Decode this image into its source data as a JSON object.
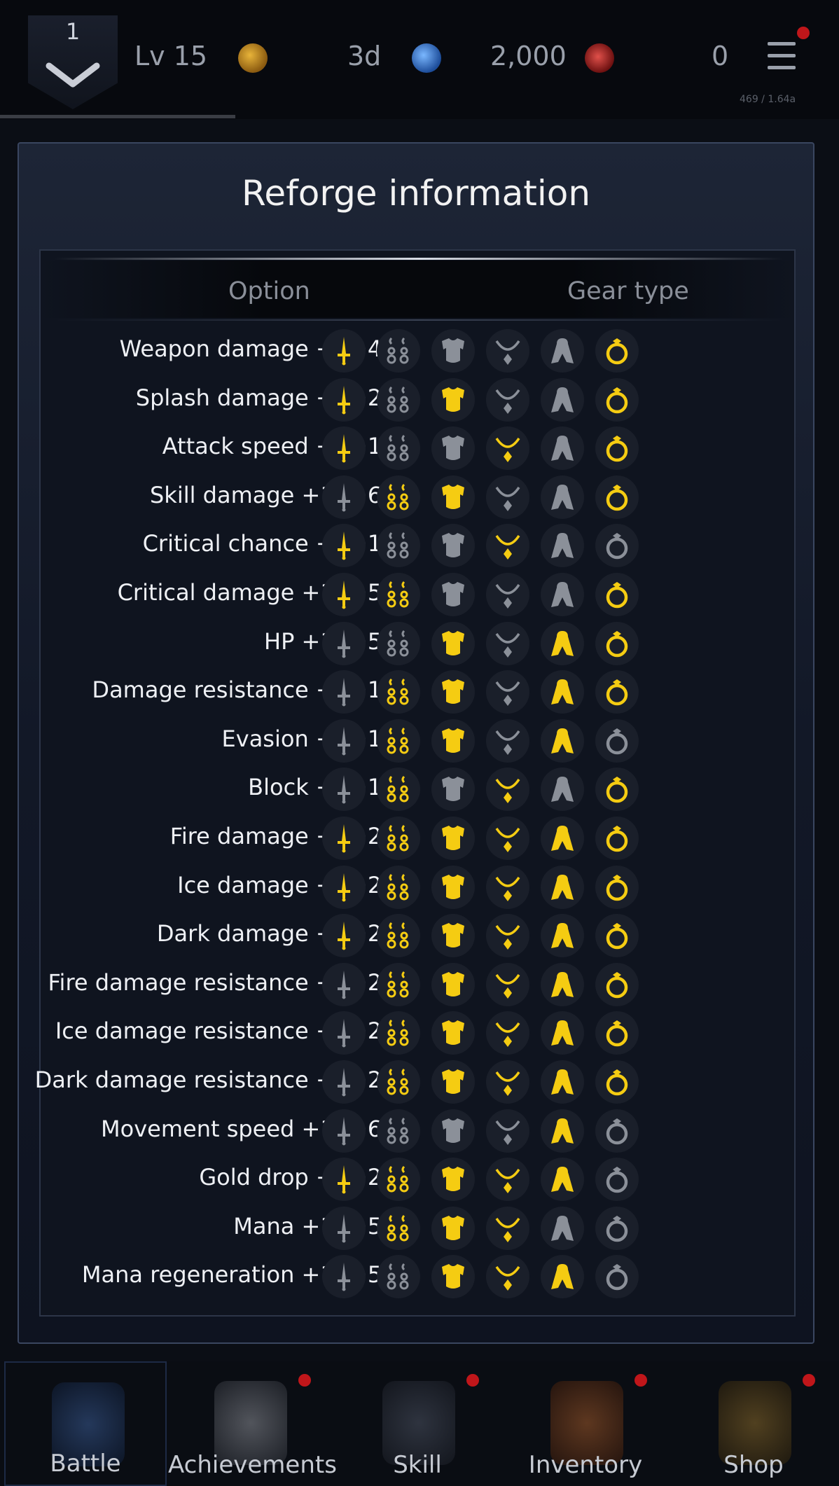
{
  "header": {
    "rank": "1",
    "level": "Lv 15",
    "resources": [
      {
        "icon": "gold-coin-icon",
        "value": "3d"
      },
      {
        "icon": "globe-gem-icon",
        "value": "2,000"
      },
      {
        "icon": "ruby-icon",
        "value": "0"
      }
    ],
    "exp_text": "469 / 1.64a"
  },
  "dialog": {
    "title": "Reforge information",
    "columns": {
      "option": "Option",
      "gear_type": "Gear type"
    },
    "gear_icons": [
      "sword-icon",
      "earring-icon",
      "armor-icon",
      "necklace-icon",
      "cloak-icon",
      "ring-icon"
    ],
    "rows": [
      {
        "label": "Weapon damage +8~40%",
        "gear": [
          1,
          0,
          0,
          0,
          0,
          1
        ]
      },
      {
        "label": "Splash damage +5~25%",
        "gear": [
          1,
          0,
          1,
          0,
          0,
          1
        ]
      },
      {
        "label": "Attack speed +2~10%",
        "gear": [
          1,
          0,
          0,
          1,
          0,
          1
        ]
      },
      {
        "label": "Skill damage +12~60%",
        "gear": [
          0,
          1,
          1,
          0,
          0,
          1
        ]
      },
      {
        "label": "Critical chance +2~10%",
        "gear": [
          1,
          0,
          0,
          1,
          0,
          0
        ]
      },
      {
        "label": "Critical damage +10~50%",
        "gear": [
          1,
          1,
          0,
          0,
          0,
          1
        ]
      },
      {
        "label": "HP +10~50%",
        "gear": [
          0,
          0,
          1,
          0,
          1,
          1
        ]
      },
      {
        "label": "Damage resistance +3~15%",
        "gear": [
          0,
          1,
          1,
          0,
          1,
          1
        ]
      },
      {
        "label": "Evasion +3~15%",
        "gear": [
          0,
          1,
          1,
          0,
          1,
          0
        ]
      },
      {
        "label": "Block +3~15%",
        "gear": [
          0,
          1,
          0,
          1,
          0,
          1
        ]
      },
      {
        "label": "Fire damage +5~25%",
        "gear": [
          1,
          1,
          1,
          1,
          1,
          1
        ]
      },
      {
        "label": "Ice damage +5~25%",
        "gear": [
          1,
          1,
          1,
          1,
          1,
          1
        ]
      },
      {
        "label": "Dark damage +5~25%",
        "gear": [
          1,
          1,
          1,
          1,
          1,
          1
        ]
      },
      {
        "label": "Fire damage resistance +5~25%",
        "gear": [
          0,
          1,
          1,
          1,
          1,
          1
        ]
      },
      {
        "label": "Ice damage resistance +5~25%",
        "gear": [
          0,
          1,
          1,
          1,
          1,
          1
        ]
      },
      {
        "label": "Dark damage resistance +5~25%",
        "gear": [
          0,
          1,
          1,
          1,
          1,
          1
        ]
      },
      {
        "label": "Movement speed +12~60%",
        "gear": [
          0,
          0,
          0,
          0,
          1,
          0
        ]
      },
      {
        "label": "Gold drop +5~25%",
        "gear": [
          1,
          1,
          1,
          1,
          1,
          0
        ]
      },
      {
        "label": "Mana +10~50%",
        "gear": [
          0,
          1,
          1,
          1,
          0,
          0
        ]
      },
      {
        "label": "Mana regeneration +10~50%",
        "gear": [
          0,
          0,
          1,
          1,
          1,
          0
        ]
      }
    ]
  },
  "nav": [
    {
      "label": "Battle",
      "icon": "battle-icon",
      "notify": false
    },
    {
      "label": "Achievements",
      "icon": "achievements-icon",
      "notify": true
    },
    {
      "label": "Skill",
      "icon": "skill-book-icon",
      "notify": true
    },
    {
      "label": "Inventory",
      "icon": "inventory-bag-icon",
      "notify": true
    },
    {
      "label": "Shop",
      "icon": "treasure-chest-icon",
      "notify": true
    }
  ],
  "colors": {
    "active_gear": "#f5cc12",
    "inactive_gear": "#8b9099",
    "notification": "#c0161a"
  }
}
